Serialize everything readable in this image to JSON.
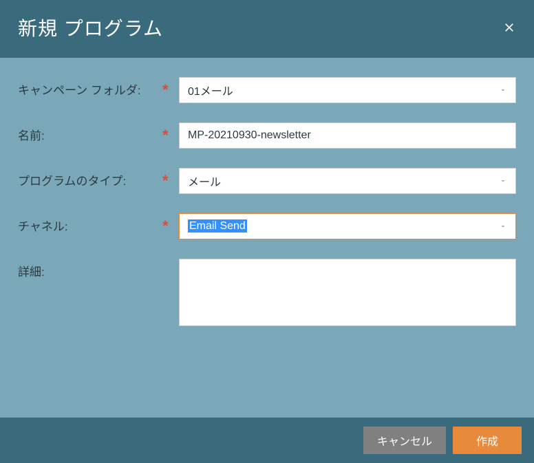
{
  "dialog": {
    "title": "新規 プログラム"
  },
  "fields": {
    "folder": {
      "label": "キャンペーン フォルダ:",
      "value": "01メール"
    },
    "name": {
      "label": "名前:",
      "value": "MP-20210930-newsletter"
    },
    "programType": {
      "label": "プログラムのタイプ:",
      "value": "メール"
    },
    "channel": {
      "label": "チャネル:",
      "value": "Email Send"
    },
    "detail": {
      "label": "詳細:",
      "value": ""
    }
  },
  "buttons": {
    "cancel": "キャンセル",
    "create": "作成"
  }
}
